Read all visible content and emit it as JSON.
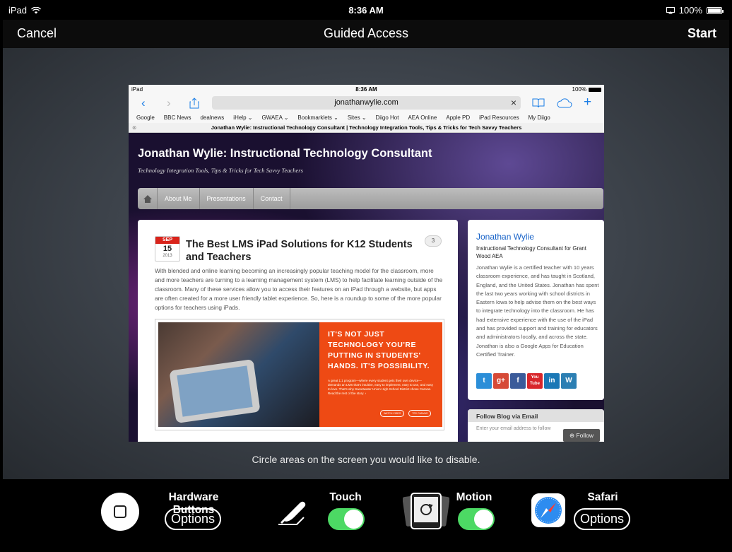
{
  "status_bar": {
    "carrier": "iPad",
    "time": "8:36 AM",
    "battery": "100%"
  },
  "nav": {
    "cancel": "Cancel",
    "title": "Guided Access",
    "start": "Start"
  },
  "instruction": "Circle areas on the screen you would like to disable.",
  "preview": {
    "status_bar": {
      "carrier": "iPad",
      "time": "8:36 AM",
      "battery": "100%"
    },
    "url": "jonathanwylie.com",
    "bookmarks": [
      "Google",
      "BBC News",
      "dealnews",
      "iHelp ⌄",
      "GWAEA ⌄",
      "Bookmarklets ⌄",
      "Sites ⌄",
      "Diigo Hot",
      "AEA Online",
      "Apple PD",
      "iPad Resources",
      "My Diigo"
    ],
    "tab_title": "Jonathan Wylie: Instructional Technology Consultant | Technology Integration Tools, Tips & Tricks for Tech Savvy Teachers",
    "site_title": "Jonathan Wylie: Instructional Technology Consultant",
    "site_tagline": "Technology Integration Tools, Tips & Tricks for Tech Savvy Teachers",
    "site_nav": [
      "About Me",
      "Presentations",
      "Contact"
    ],
    "post": {
      "date_month": "SEP",
      "date_day": "15",
      "date_year": "2013",
      "title": "The Best LMS iPad Solutions for K12 Students and Teachers",
      "comments": "3",
      "body": "With blended and online learning becoming an increasingly popular teaching model for the classroom, more and more teachers are turning to a learning management system (LMS) to help facilitate learning outside of the classroom. Many of these services allow you to access their features on an iPad through a website, but apps are often created for a more user friendly tablet experience. So, here is a roundup to some of the more popular options for teachers using iPads.",
      "promo_headline": "IT'S NOT JUST TECHNOLOGY YOU'RE PUTTING IN STUDENTS' HANDS. IT'S POSSIBILITY.",
      "promo_fine": "A great 1:1 program—where every student gets their own device—demands an LMS that's intuitive, easy to implement, easy to use, and easy to love. That's why Sweetwater Union High School District chose Canvas. Read the rest of the story. ›",
      "promo_btn1": "WATCH VIDEO",
      "promo_btn2": "TRY CANVAS"
    },
    "sidebar": {
      "name": "Jonathan Wylie",
      "role": "Instructional Technology Consultant for Grant Wood AEA",
      "bio": "Jonathan Wylie is a certified teacher with 10 years classroom experience, and has taught in Scotland, England, and the United States. Jonathan has spent the last two years working with school districts in Eastern Iowa to help advise them on the best ways to integrate technology into the classroom. He has had extensive experience with the use of the iPad and has provided support and training for educators and administrators locally, and across the state. Jonathan is also a Google Apps for Education Certified Trainer.",
      "social": [
        {
          "icon": "twitter-icon",
          "glyph": "t",
          "color": "#2b8ed8"
        },
        {
          "icon": "google-plus-icon",
          "glyph": "g+",
          "color": "#d64a37"
        },
        {
          "icon": "facebook-icon",
          "glyph": "f",
          "color": "#3b5b9a"
        },
        {
          "icon": "youtube-icon",
          "glyph": "You Tube",
          "color": "#d8262b"
        },
        {
          "icon": "linkedin-icon",
          "glyph": "in",
          "color": "#1b78b6"
        },
        {
          "icon": "wordpress-icon",
          "glyph": "W",
          "color": "#2c7fb3"
        }
      ],
      "follow_heading": "Follow Blog via Email",
      "follow_field": "Enter your email address to follow",
      "follow_button": "⊕ Follow"
    }
  },
  "options": {
    "hardware": {
      "title": "Hardware Buttons",
      "button": "Options"
    },
    "touch": {
      "title": "Touch",
      "enabled": true
    },
    "motion": {
      "title": "Motion",
      "enabled": true
    },
    "safari": {
      "title": "Safari",
      "button": "Options"
    }
  },
  "colors": {
    "toggle_on": "#4cd964",
    "link_blue": "#1a7de6"
  }
}
